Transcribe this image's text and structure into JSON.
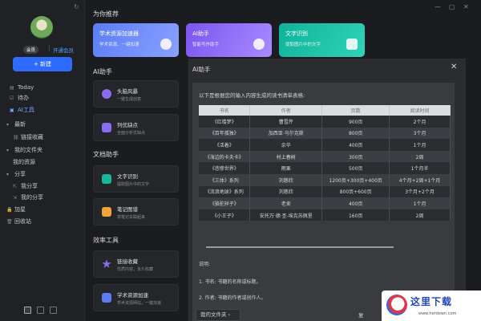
{
  "sidebar": {
    "badge": "会员",
    "vip_link": "开通会员",
    "new_button": "+ 新建",
    "items": [
      {
        "icon": "calendar-icon",
        "glyph": "▤",
        "label": "Today"
      },
      {
        "icon": "checkbox-icon",
        "glyph": "☑",
        "label": "待办"
      },
      {
        "icon": "ai-tools-icon",
        "glyph": "▣",
        "label": "AI工具"
      },
      {
        "icon": "chevron-down-icon",
        "glyph": "▾",
        "label": "最新"
      },
      {
        "icon": "link-icon",
        "glyph": "⛓",
        "label": "链接收藏"
      },
      {
        "icon": "folder-icon",
        "glyph": "▾",
        "label": "我的文件夹"
      },
      {
        "icon": "",
        "glyph": "",
        "label": "我的资源"
      },
      {
        "icon": "share-icon",
        "glyph": "▾",
        "label": "分享"
      },
      {
        "icon": "share-out-icon",
        "glyph": "⇱",
        "label": "我分享"
      },
      {
        "icon": "share-in-icon",
        "glyph": "⇲",
        "label": "我的分享"
      },
      {
        "icon": "lock-icon",
        "glyph": "🔒",
        "label": "加星"
      },
      {
        "icon": "trash-icon",
        "glyph": "🗑",
        "label": "回收站"
      }
    ]
  },
  "main": {
    "recommend_title": "为你推荐",
    "top_cards": [
      {
        "title": "学术资源加速器",
        "desc": "学术资源、一键加速",
        "color": "#5b7cf6"
      },
      {
        "title": "AI助手",
        "desc": "智能写作助手",
        "color": "#8a5cf2"
      },
      {
        "title": "文字识别",
        "desc": "提取图片中的文字",
        "color": "#13bca0"
      }
    ],
    "sections": [
      {
        "title": "AI助手",
        "tools": [
          {
            "title": "头脑风暴",
            "desc": "一键生成创意",
            "color": "#8a6cf0"
          },
          {
            "title": "列优缺点",
            "desc": "全面分析优缺点",
            "color": "#8a6cf0"
          }
        ]
      },
      {
        "title": "文档助手",
        "tools": [
          {
            "title": "文字识别",
            "desc": "提取图片中的文字",
            "color": "#17b79a"
          },
          {
            "title": "笔记图谱",
            "desc": "将笔记关联起来",
            "color": "#f0a23b"
          }
        ]
      },
      {
        "title": "效率工具",
        "tools": [
          {
            "title": "链接收藏",
            "desc": "优质内容，永久收藏",
            "color": "#8a6cf0"
          },
          {
            "title": "学术资源加速",
            "desc": "学术资源网站，一键加速",
            "color": "#5b7cf6"
          }
        ]
      }
    ]
  },
  "panel": {
    "title": "AI助手",
    "intro": "以下是根据您的输入内容生成的读书清单表格:",
    "headers": [
      "书名",
      "作者",
      "页数",
      "阅读时间"
    ],
    "rows": [
      [
        "《红楼梦》",
        "曹雪芹",
        "900页",
        "2个月"
      ],
      [
        "《百年孤独》",
        "加西亚·马尔克斯",
        "800页",
        "3个月"
      ],
      [
        "《活着》",
        "余华",
        "400页",
        "1个月"
      ],
      [
        "《海边的卡夫卡》",
        "村上春树",
        "300页",
        "2周"
      ],
      [
        "《悲惨世界》",
        "雨果",
        "500页",
        "1个月半"
      ],
      [
        "《三体》系列",
        "刘慈欣",
        "1200页+300页+400页",
        "4个月+2周+1个月"
      ],
      [
        "《流浪地球》系列",
        "刘慈欣",
        "800页+600页",
        "3个月+2个月"
      ],
      [
        "《骆驼祥子》",
        "老舍",
        "400页",
        "1个月"
      ],
      [
        "《小王子》",
        "安托万·德·圣-埃克苏佩里",
        "160页",
        "2周"
      ]
    ],
    "note_title": "说明:",
    "note_1": "1. 书名: 书籍的名称或标题。",
    "note_2": "2. 作者: 书籍的作者或创作人。",
    "folder_button": "我的文件夹 ›",
    "clip_label": "复"
  },
  "watermark": {
    "brand": "这里下载",
    "url": "www.herdown.com"
  }
}
